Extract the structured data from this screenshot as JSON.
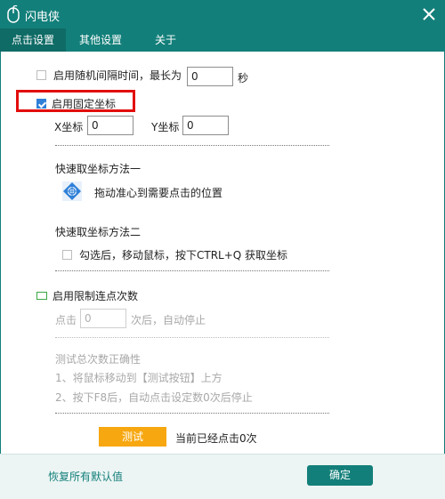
{
  "window": {
    "title": "闪电侠"
  },
  "tabs": [
    {
      "label": "点击设置",
      "active": true
    },
    {
      "label": "其他设置",
      "active": false
    },
    {
      "label": "关于",
      "active": false
    }
  ],
  "random_interval": {
    "label": "启用随机间隔时间，最长为",
    "value": "0",
    "unit": "秒",
    "checked": false
  },
  "fixed_coord": {
    "label": "启用固定坐标",
    "checked": true
  },
  "coords": {
    "x_label": "X坐标",
    "x_value": "0",
    "y_label": "Y坐标",
    "y_value": "0"
  },
  "method1": {
    "title": "快速取坐标方法一",
    "desc": "拖动准心到需要点击的位置"
  },
  "method2": {
    "title": "快速取坐标方法二",
    "checkbox_label": "勾选后，移动鼠标，按下CTRL+Q 获取坐标",
    "checked": false
  },
  "limit_clicks": {
    "label": "启用限制连点次数",
    "checked": false
  },
  "click_count": {
    "prefix": "点击",
    "value": "0",
    "suffix": "次后，自动停止"
  },
  "test_section": {
    "title": "测试总次数正确性",
    "step1": "1、将鼠标移动到【测试按钮】上方",
    "step2": "2、按下F8后，自动点击设定数0次后停止",
    "test_button": "测试",
    "status": "当前已经点击0次"
  },
  "footer": {
    "restore_label": "恢复所有默认值",
    "ok_label": "确定"
  },
  "colors": {
    "accent": "#137f7a",
    "highlight": "#e30d0d",
    "test_button": "#f7a70f",
    "checked": "#2f80d8"
  }
}
